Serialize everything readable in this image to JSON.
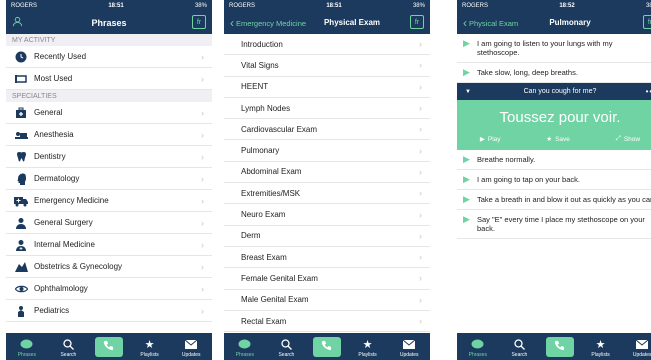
{
  "status": {
    "carrier": "ROGERS",
    "time1": "18:51",
    "time2": "18:51",
    "time3": "18:52",
    "battery": "38%"
  },
  "screen1": {
    "title": "Phrases",
    "lang_button": "fr",
    "section_activity": "MY ACTIVITY",
    "activity": [
      {
        "label": "Recently Used",
        "icon": "clock-icon"
      },
      {
        "label": "Most Used",
        "icon": "frame-icon"
      }
    ],
    "section_specialties": "SPECIALTIES",
    "specialties": [
      {
        "label": "General",
        "icon": "medkit-icon"
      },
      {
        "label": "Anesthesia",
        "icon": "bed-icon"
      },
      {
        "label": "Dentistry",
        "icon": "tooth-icon"
      },
      {
        "label": "Dermatology",
        "icon": "head-icon"
      },
      {
        "label": "Emergency Medicine",
        "icon": "ambulance-icon"
      },
      {
        "label": "General Surgery",
        "icon": "surgeon-icon"
      },
      {
        "label": "Internal Medicine",
        "icon": "doctor-icon"
      },
      {
        "label": "Obstetrics & Gynecology",
        "icon": "pregnancy-icon"
      },
      {
        "label": "Ophthalmology",
        "icon": "eye-icon"
      },
      {
        "label": "Pediatrics",
        "icon": "child-icon"
      }
    ]
  },
  "screen2": {
    "back_label": "Emergency Medicine",
    "title": "Physical Exam",
    "lang_button": "fr",
    "items": [
      "Introduction",
      "Vital Signs",
      "HEENT",
      "Lymph Nodes",
      "Cardiovascular Exam",
      "Pulmonary",
      "Abdominal Exam",
      "Extremities/MSK",
      "Neuro Exam",
      "Derm",
      "Breast Exam",
      "Female Genital Exam",
      "Male Genital Exam",
      "Rectal Exam"
    ]
  },
  "screen3": {
    "back_label": "Physical Exam",
    "title": "Pulmonary",
    "lang_button": "fr",
    "phrases_before": [
      "I am going to listen to your lungs with my stethoscope.",
      "Take slow, long, deep breaths."
    ],
    "expanded_english": "Can you cough for me?",
    "expanded_french": "Toussez pour voir.",
    "action_play": "Play",
    "action_save": "Save",
    "action_show": "Show",
    "phrases_after": [
      "Breathe normally.",
      "I am going to tap on your back.",
      "Take a breath in and blow it out as quickly as you can.",
      "Say \"E\" every time I place my stethoscope on your back."
    ]
  },
  "tabbar": {
    "phrases": "Phrases",
    "search": "Search",
    "playlists": "Playlists",
    "updates": "Updates"
  },
  "colors": {
    "navy": "#1c3a5e",
    "accent": "#6fd3a4"
  }
}
